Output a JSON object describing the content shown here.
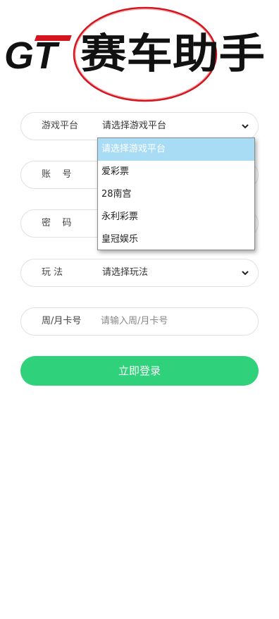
{
  "logo": {
    "brand_letters": "GT",
    "brand_name": "赛车助手"
  },
  "form": {
    "platform": {
      "label": "游戏平台",
      "value": "请选择游戏平台"
    },
    "account": {
      "label": "账    号"
    },
    "password": {
      "label": "密    码"
    },
    "play": {
      "label": "玩 法",
      "value": "请选择玩法"
    },
    "card": {
      "label": "周/月卡号",
      "placeholder": "请输入周/月卡号"
    },
    "submit_label": "立即登录"
  },
  "dropdown": {
    "options": [
      {
        "label": "请选择游戏平台",
        "selected": true
      },
      {
        "label": "爱彩票"
      },
      {
        "label": "28南宫"
      },
      {
        "label": "永利彩票"
      },
      {
        "label": "皇冠娱乐"
      }
    ]
  },
  "colors": {
    "accent": "#2fd27a",
    "logo_red": "#d4141f",
    "option_highlight": "#a8dcf5"
  },
  "icons": {
    "select_arrow": "chevron-down-icon"
  }
}
